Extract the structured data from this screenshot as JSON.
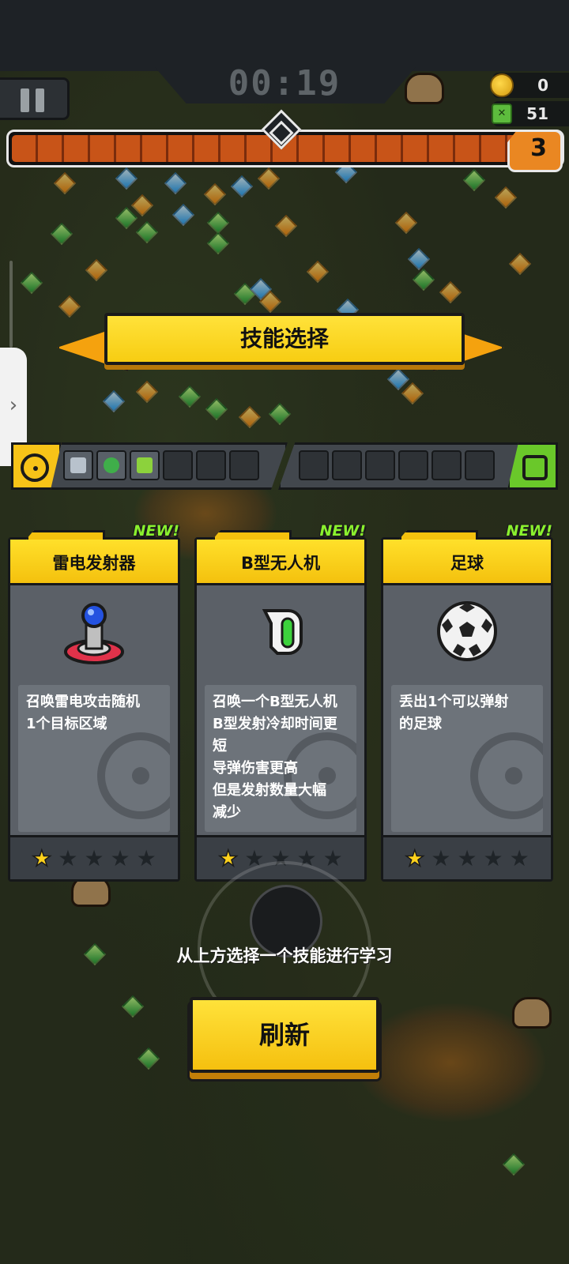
{
  "hud": {
    "timer": "00:19",
    "coins": "0",
    "kills": "51",
    "level": "3",
    "xp_progress": 0.94
  },
  "banner": {
    "title": "技能选择"
  },
  "slots": {
    "weapon_icon": "crosshair-icon",
    "passive_icon": "passive-chip-icon",
    "weapon_slots": [
      "knife-icon",
      "bomb-icon",
      "bottle-icon",
      "",
      "",
      ""
    ],
    "passive_slots": [
      "",
      "",
      "",
      "",
      "",
      ""
    ]
  },
  "cards": [
    {
      "new_badge": "NEW!",
      "name": "雷电发射器",
      "icon": "lightning-launcher-icon",
      "description": "召唤雷电攻击随机\n1个目标区域",
      "stars_filled": 1,
      "stars_total": 5
    },
    {
      "new_badge": "NEW!",
      "name": "B型无人机",
      "icon": "drone-icon",
      "description": "召唤一个B型无人机\nB型发射冷却时间更\n短\n导弹伤害更高\n但是发射数量大幅\n减少",
      "stars_filled": 1,
      "stars_total": 5
    },
    {
      "new_badge": "NEW!",
      "name": "足球",
      "icon": "soccer-ball-icon",
      "description": "丢出1个可以弹射\n的足球",
      "stars_filled": 1,
      "stars_total": 5
    }
  ],
  "instruction": "从上方选择一个技能进行学习",
  "refresh_button": "刷新",
  "colors": {
    "accent_yellow": "#f7c318",
    "xp_orange": "#c85418",
    "new_green": "#8af02e",
    "card_gray": "#5b6067"
  }
}
